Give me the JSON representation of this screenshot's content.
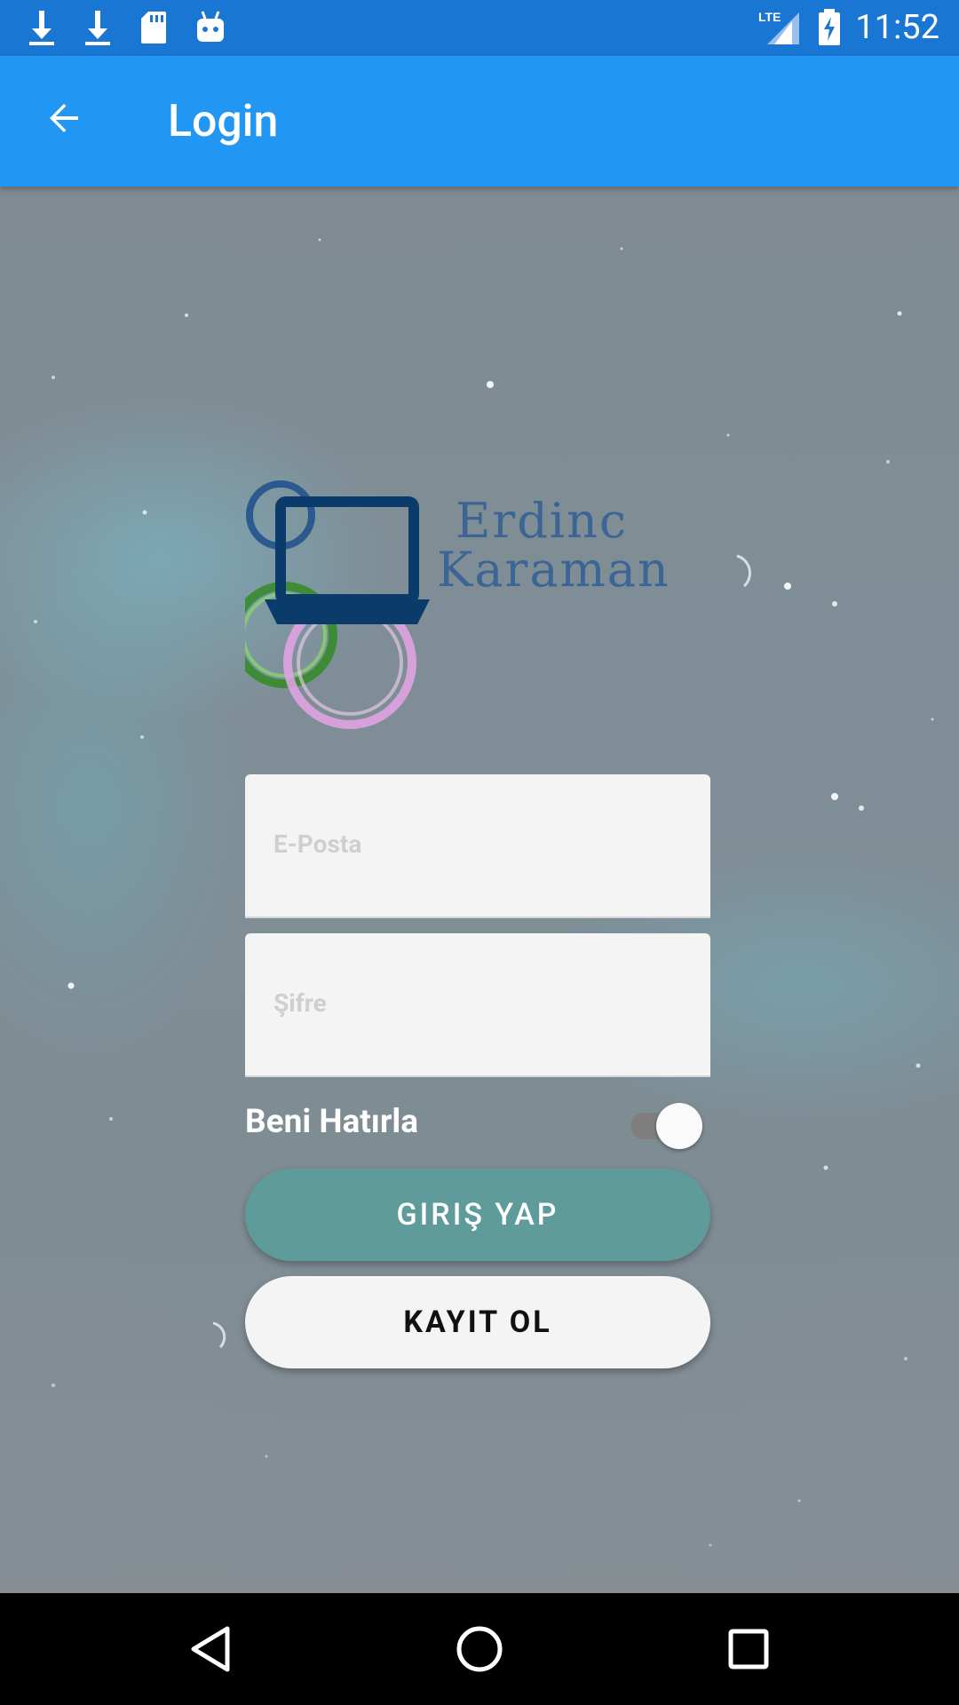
{
  "status_bar": {
    "time": "11:52",
    "network_label": "LTE",
    "icons": [
      "download-icon",
      "download-icon",
      "sd-card-icon",
      "android-icon",
      "signal-icon",
      "battery-charging-icon"
    ]
  },
  "app_bar": {
    "title": "Login",
    "back_icon": "arrow-back-icon",
    "color": "#2196F3"
  },
  "logo": {
    "line1": "Erdinc",
    "line2": "Karaman"
  },
  "form": {
    "email_placeholder": "E-Posta",
    "password_placeholder": "Şifre",
    "remember_label": "Beni Hatırla",
    "remember_on": true,
    "login_button": "GIRIŞ YAP",
    "register_button": "KAYIT OL",
    "login_color": "#5f9b9b"
  },
  "nav_bar": {
    "icons": [
      "back-triangle-icon",
      "home-circle-icon",
      "recents-square-icon"
    ]
  }
}
